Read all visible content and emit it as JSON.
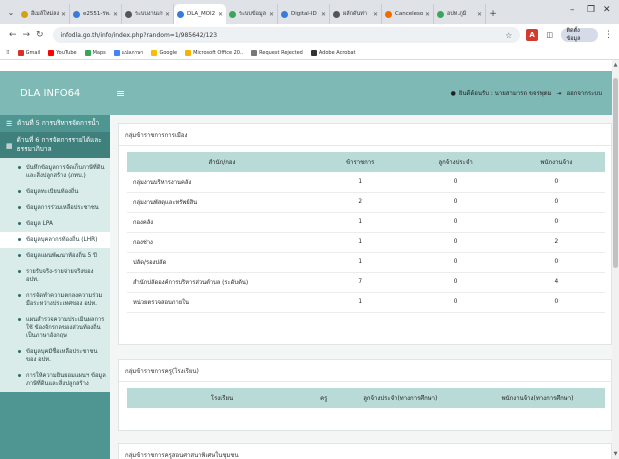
{
  "browser": {
    "tabs": [
      {
        "label": "อีเมล์ใหม่ลง",
        "color": "#d4a017"
      },
      {
        "label": "e2551-รพ.",
        "color": "#3a7bd5"
      },
      {
        "label": "ระบบงานเกษตร",
        "color": "#555555"
      },
      {
        "label": "DLA_MOI2",
        "color": "#3a7bd5",
        "active": true
      },
      {
        "label": "ระบบข้อมูล",
        "color": "#3aa55d"
      },
      {
        "label": "Digital-ID",
        "color": "#3a7bd5"
      },
      {
        "label": "ผลักดันท่า",
        "color": "#555555"
      },
      {
        "label": "Canceleso",
        "color": "#ef6c00"
      },
      {
        "label": "อปท.ภูมิ",
        "color": "#3aa55d"
      }
    ],
    "url": "infodla.go.th/info/index.php?random=1/985642/123",
    "profile": "ติดตั้งข้อมูล",
    "bookmarks": [
      {
        "label": "Gmail",
        "color": "#d93025"
      },
      {
        "label": "YouTube",
        "color": "#ff0000"
      },
      {
        "label": "Maps",
        "color": "#34a853"
      },
      {
        "label": "แปลภาษา",
        "color": "#4285f4"
      },
      {
        "label": "Google",
        "color": "#fbbc05"
      },
      {
        "label": "Microsoft Office 20..",
        "color": "#f4b400"
      },
      {
        "label": "Request Rejected",
        "color": "#777777"
      },
      {
        "label": "Adobe Acrobat",
        "color": "#333333"
      }
    ]
  },
  "app": {
    "brand": "DLA INFO64",
    "hamburger": "≡",
    "user_label": "ยินดีต้อนรับ : นายสามารถ ขจรพุดม",
    "logout_label": "ออกจากระบบ"
  },
  "sidebar": {
    "section5": "ด้านที่ 5 การบริหารจัดการน้ำ",
    "section6": "ด้านที่ 6 การจัดการรายได้และ ธรรมาภิบาล",
    "items": [
      "บันทึกข้อมูลการจัดเก็บภาษีที่ดิน และสิ่งปลูกสร้าง (ภทบ.)",
      "ข้อมูลทะเบียนท้องถิ่น",
      "ข้อมูลการร่วมเหลือประชาชน",
      "ข้อมูล LPA",
      "ข้อมูลบุคลากรท้องถิ่น (LHR)",
      "ข้อมูลแผนพัฒนาท้องถิ่น 5 ปี",
      "รายรับจริง-รายจ่ายจริงของ อปท.",
      "การจัดทำความตกลงความร่วม มือระหว่างประเทศของ อปท.",
      "แผนสำรวจความประเมินผลการใช้ ข้องจักรกลของส่วนท้องถิ่น เป็นภาษาอังกฤษ",
      "ข้อมูลบุคมีชื่อเหลือประชาชน ของ อปท.",
      "การให้ความยินยอมแผนฯ ข้อมูลภาษีที่ดินและสิ่งปลูกสร้าง"
    ],
    "active_index": 4
  },
  "card1": {
    "title": "กลุ่มข้าราชการการเมือง",
    "headers": [
      "สำนัก/กอง",
      "ข้าราชการ",
      "ลูกจ้างประจำ",
      "พนักงานจ้าง"
    ],
    "rows": [
      [
        "กลุ่มงานบริหารงานคลัง",
        "1",
        "0",
        "0"
      ],
      [
        "กลุ่มงานพัสดุและทรัพย์สิน",
        "2",
        "0",
        "0"
      ],
      [
        "กองคลัง",
        "1",
        "0",
        "0"
      ],
      [
        "กองช่าง",
        "1",
        "0",
        "2"
      ],
      [
        "ปลัด/รองปลัด",
        "1",
        "0",
        "0"
      ],
      [
        "สำนักปลัดองค์การบริหารส่วนตำบล (ระดับต้น)",
        "7",
        "0",
        "4"
      ],
      [
        "หน่วยตรวจสอบภายใน",
        "1",
        "0",
        "0"
      ]
    ]
  },
  "card2": {
    "title": "กลุ่มข้าราชการครู(โรงเรียน)",
    "headers": [
      "โรงเรียน",
      "ครู",
      "ลูกจ้างประจำ(ทางการศึกษา)",
      "พนักงานจ้าง(ทางการศึกษา)"
    ]
  },
  "card3": {
    "title": "กลุ่มข้าราชการครูสอนศาสนาพิเศษในชุมชน"
  }
}
